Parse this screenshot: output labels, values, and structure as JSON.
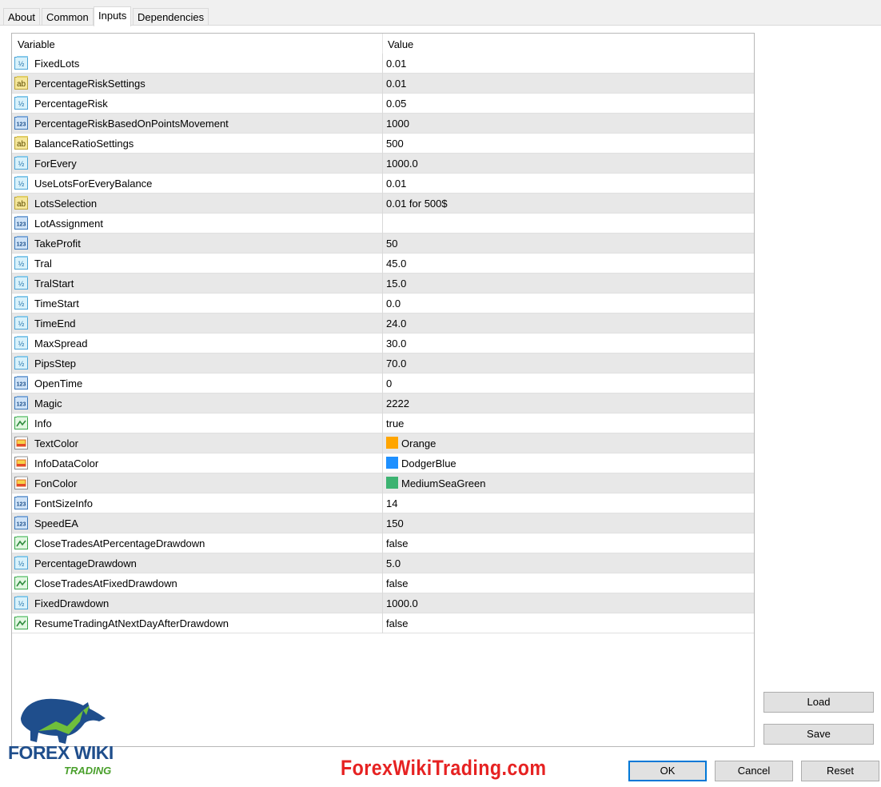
{
  "tabs": [
    {
      "label": "About",
      "active": false
    },
    {
      "label": "Common",
      "active": false
    },
    {
      "label": "Inputs",
      "active": true
    },
    {
      "label": "Dependencies",
      "active": false
    }
  ],
  "grid": {
    "columns": {
      "variable": "Variable",
      "value": "Value"
    },
    "rows": [
      {
        "icon": "double-icon",
        "name": "FixedLots",
        "value": "0.01"
      },
      {
        "icon": "string-icon",
        "name": "PercentageRiskSettings",
        "value": "0.01"
      },
      {
        "icon": "double-icon",
        "name": "PercentageRisk",
        "value": "0.05"
      },
      {
        "icon": "integer-icon",
        "name": "PercentageRiskBasedOnPointsMovement",
        "value": "1000"
      },
      {
        "icon": "string-icon",
        "name": "BalanceRatioSettings",
        "value": "500"
      },
      {
        "icon": "double-icon",
        "name": "ForEvery",
        "value": "1000.0"
      },
      {
        "icon": "double-icon",
        "name": "UseLotsForEveryBalance",
        "value": "0.01"
      },
      {
        "icon": "string-icon",
        "name": "LotsSelection",
        "value": "0.01 for 500$"
      },
      {
        "icon": "integer-icon",
        "name": "LotAssignment",
        "value": ""
      },
      {
        "icon": "integer-icon",
        "name": "TakeProfit",
        "value": "50"
      },
      {
        "icon": "double-icon",
        "name": "Tral",
        "value": "45.0"
      },
      {
        "icon": "double-icon",
        "name": "TralStart",
        "value": "15.0"
      },
      {
        "icon": "double-icon",
        "name": "TimeStart",
        "value": "0.0"
      },
      {
        "icon": "double-icon",
        "name": "TimeEnd",
        "value": "24.0"
      },
      {
        "icon": "double-icon",
        "name": "MaxSpread",
        "value": "30.0"
      },
      {
        "icon": "double-icon",
        "name": "PipsStep",
        "value": "70.0"
      },
      {
        "icon": "integer-icon",
        "name": "OpenTime",
        "value": "0"
      },
      {
        "icon": "integer-icon",
        "name": "Magic",
        "value": "2222"
      },
      {
        "icon": "bool-icon",
        "name": "Info",
        "value": "true"
      },
      {
        "icon": "color-icon",
        "name": "TextColor",
        "value": "Orange",
        "swatch": "#ffa500"
      },
      {
        "icon": "color-icon",
        "name": "InfoDataColor",
        "value": "DodgerBlue",
        "swatch": "#1e90ff"
      },
      {
        "icon": "color-icon",
        "name": "FonColor",
        "value": "MediumSeaGreen",
        "swatch": "#3cb371"
      },
      {
        "icon": "integer-icon",
        "name": "FontSizeInfo",
        "value": "14"
      },
      {
        "icon": "integer-icon",
        "name": "SpeedEA",
        "value": "150"
      },
      {
        "icon": "bool-icon",
        "name": "CloseTradesAtPercentageDrawdown",
        "value": "false"
      },
      {
        "icon": "double-icon",
        "name": "PercentageDrawdown",
        "value": "5.0"
      },
      {
        "icon": "bool-icon",
        "name": "CloseTradesAtFixedDrawdown",
        "value": "false"
      },
      {
        "icon": "double-icon",
        "name": "FixedDrawdown",
        "value": "1000.0"
      },
      {
        "icon": "bool-icon",
        "name": "ResumeTradingAtNextDayAfterDrawdown",
        "value": "false"
      }
    ]
  },
  "buttons": {
    "load": "Load",
    "save": "Save",
    "ok": "OK",
    "cancel": "Cancel",
    "reset": "Reset"
  },
  "logo": {
    "brand": "FOREX WIKI",
    "sub": "TRADING"
  },
  "watermark": "ForexWikiTrading.com"
}
